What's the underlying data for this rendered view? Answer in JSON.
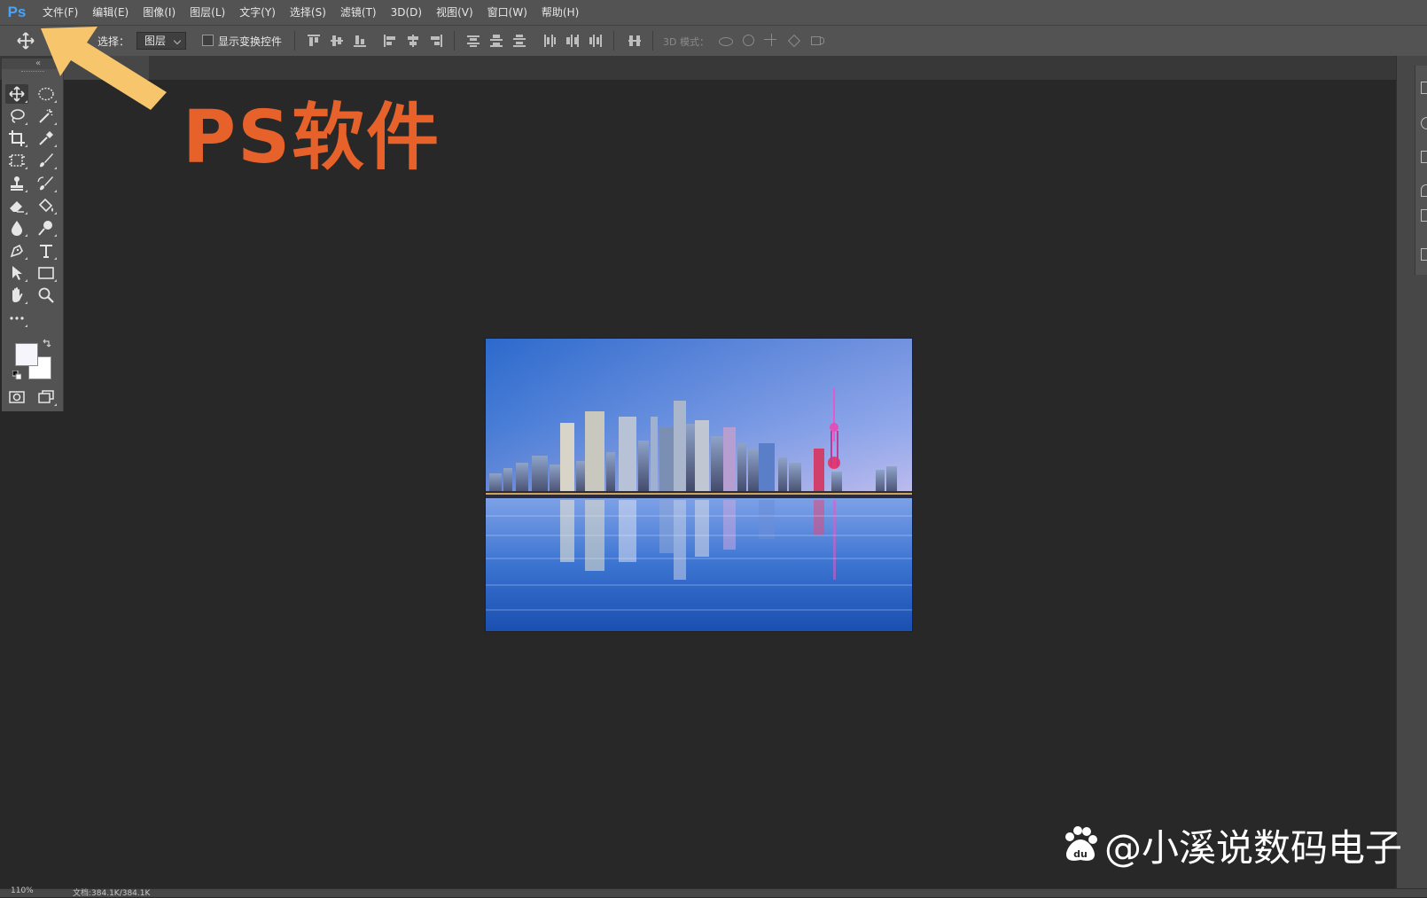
{
  "app": {
    "logo_text": "Ps",
    "menu": [
      "文件(F)",
      "编辑(E)",
      "图像(I)",
      "图层(L)",
      "文字(Y)",
      "选择(S)",
      "滤镜(T)",
      "3D(D)",
      "视图(V)",
      "窗口(W)",
      "帮助(H)"
    ]
  },
  "options": {
    "select_label": "选择：",
    "select_value": "图层",
    "show_transform_label": "显示变换控件",
    "mode3d_label": "3D 模式："
  },
  "status": {
    "zoom": "110%",
    "doc_info": "文档:384.1K/384.1K"
  },
  "annotation": {
    "title": "PS软件"
  },
  "watermark": {
    "text": "@小溪说数码电子"
  },
  "colors": {
    "foreground": "#f6f5fb",
    "background": "#ffffff",
    "accent_orange": "#e7622a",
    "arrow_yellow": "#f7c56b",
    "ps_blue": "#4aa3f5"
  },
  "tools": [
    "move-tool",
    "elliptical-marquee-tool",
    "lasso-tool",
    "magic-wand-tool",
    "crop-tool",
    "eyedropper-tool",
    "frame-tool",
    "brush-tool",
    "clone-stamp-tool",
    "history-brush-tool",
    "eraser-tool",
    "paint-bucket-tool",
    "blur-tool",
    "dodge-tool",
    "pen-tool",
    "type-tool",
    "path-selection-tool",
    "rectangle-tool",
    "hand-tool",
    "zoom-tool",
    "more-tools"
  ]
}
